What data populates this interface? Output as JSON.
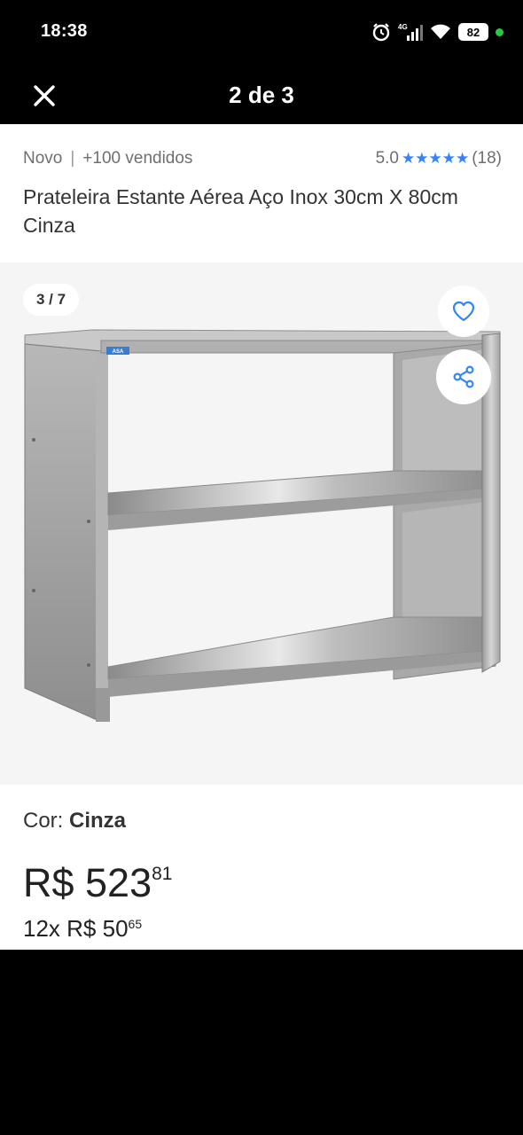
{
  "status_bar": {
    "time": "18:38",
    "network": "4G",
    "battery": "82"
  },
  "header": {
    "close_icon": "close-icon",
    "title": "2 de 3"
  },
  "product": {
    "condition": "Novo",
    "separator": "|",
    "sold": "+100 vendidos",
    "rating": "5.0",
    "stars": "★★★★★",
    "reviews": "(18)",
    "title": "Prateleira Estante Aérea Aço Inox 30cm X 80cm  Cinza"
  },
  "gallery": {
    "counter": "3 / 7",
    "image_brand": "ASA",
    "favorite_icon": "heart-icon",
    "share_icon": "share-icon"
  },
  "variant": {
    "label": "Cor: ",
    "value": "Cinza"
  },
  "pricing": {
    "price_main": "R$ 523",
    "price_cents": "81",
    "installments_main": "12x R$ 50",
    "installments_cents": "65"
  },
  "colors": {
    "accent": "#3483fa",
    "star": "#3483fa",
    "background": "#000000",
    "sheet": "#ffffff",
    "gallery_bg": "#f5f5f5"
  }
}
